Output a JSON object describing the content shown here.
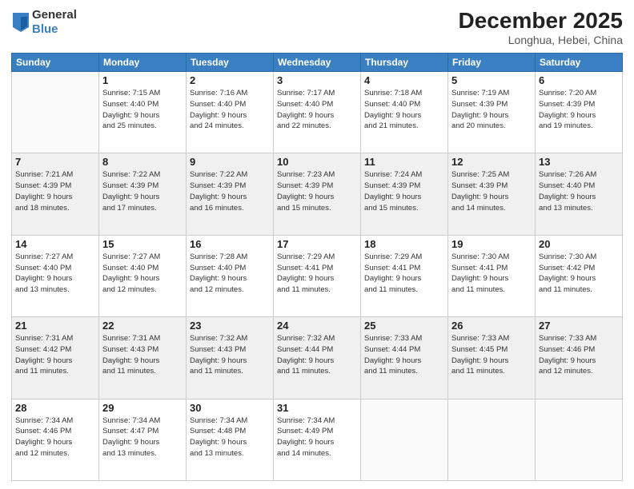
{
  "logo": {
    "general": "General",
    "blue": "Blue"
  },
  "title": {
    "month": "December 2025",
    "location": "Longhua, Hebei, China"
  },
  "weekdays": [
    "Sunday",
    "Monday",
    "Tuesday",
    "Wednesday",
    "Thursday",
    "Friday",
    "Saturday"
  ],
  "weeks": [
    [
      {
        "day": "",
        "detail": ""
      },
      {
        "day": "1",
        "detail": "Sunrise: 7:15 AM\nSunset: 4:40 PM\nDaylight: 9 hours\nand 25 minutes."
      },
      {
        "day": "2",
        "detail": "Sunrise: 7:16 AM\nSunset: 4:40 PM\nDaylight: 9 hours\nand 24 minutes."
      },
      {
        "day": "3",
        "detail": "Sunrise: 7:17 AM\nSunset: 4:40 PM\nDaylight: 9 hours\nand 22 minutes."
      },
      {
        "day": "4",
        "detail": "Sunrise: 7:18 AM\nSunset: 4:40 PM\nDaylight: 9 hours\nand 21 minutes."
      },
      {
        "day": "5",
        "detail": "Sunrise: 7:19 AM\nSunset: 4:39 PM\nDaylight: 9 hours\nand 20 minutes."
      },
      {
        "day": "6",
        "detail": "Sunrise: 7:20 AM\nSunset: 4:39 PM\nDaylight: 9 hours\nand 19 minutes."
      }
    ],
    [
      {
        "day": "7",
        "detail": "Sunrise: 7:21 AM\nSunset: 4:39 PM\nDaylight: 9 hours\nand 18 minutes."
      },
      {
        "day": "8",
        "detail": "Sunrise: 7:22 AM\nSunset: 4:39 PM\nDaylight: 9 hours\nand 17 minutes."
      },
      {
        "day": "9",
        "detail": "Sunrise: 7:22 AM\nSunset: 4:39 PM\nDaylight: 9 hours\nand 16 minutes."
      },
      {
        "day": "10",
        "detail": "Sunrise: 7:23 AM\nSunset: 4:39 PM\nDaylight: 9 hours\nand 15 minutes."
      },
      {
        "day": "11",
        "detail": "Sunrise: 7:24 AM\nSunset: 4:39 PM\nDaylight: 9 hours\nand 15 minutes."
      },
      {
        "day": "12",
        "detail": "Sunrise: 7:25 AM\nSunset: 4:39 PM\nDaylight: 9 hours\nand 14 minutes."
      },
      {
        "day": "13",
        "detail": "Sunrise: 7:26 AM\nSunset: 4:40 PM\nDaylight: 9 hours\nand 13 minutes."
      }
    ],
    [
      {
        "day": "14",
        "detail": "Sunrise: 7:27 AM\nSunset: 4:40 PM\nDaylight: 9 hours\nand 13 minutes."
      },
      {
        "day": "15",
        "detail": "Sunrise: 7:27 AM\nSunset: 4:40 PM\nDaylight: 9 hours\nand 12 minutes."
      },
      {
        "day": "16",
        "detail": "Sunrise: 7:28 AM\nSunset: 4:40 PM\nDaylight: 9 hours\nand 12 minutes."
      },
      {
        "day": "17",
        "detail": "Sunrise: 7:29 AM\nSunset: 4:41 PM\nDaylight: 9 hours\nand 11 minutes."
      },
      {
        "day": "18",
        "detail": "Sunrise: 7:29 AM\nSunset: 4:41 PM\nDaylight: 9 hours\nand 11 minutes."
      },
      {
        "day": "19",
        "detail": "Sunrise: 7:30 AM\nSunset: 4:41 PM\nDaylight: 9 hours\nand 11 minutes."
      },
      {
        "day": "20",
        "detail": "Sunrise: 7:30 AM\nSunset: 4:42 PM\nDaylight: 9 hours\nand 11 minutes."
      }
    ],
    [
      {
        "day": "21",
        "detail": "Sunrise: 7:31 AM\nSunset: 4:42 PM\nDaylight: 9 hours\nand 11 minutes."
      },
      {
        "day": "22",
        "detail": "Sunrise: 7:31 AM\nSunset: 4:43 PM\nDaylight: 9 hours\nand 11 minutes."
      },
      {
        "day": "23",
        "detail": "Sunrise: 7:32 AM\nSunset: 4:43 PM\nDaylight: 9 hours\nand 11 minutes."
      },
      {
        "day": "24",
        "detail": "Sunrise: 7:32 AM\nSunset: 4:44 PM\nDaylight: 9 hours\nand 11 minutes."
      },
      {
        "day": "25",
        "detail": "Sunrise: 7:33 AM\nSunset: 4:44 PM\nDaylight: 9 hours\nand 11 minutes."
      },
      {
        "day": "26",
        "detail": "Sunrise: 7:33 AM\nSunset: 4:45 PM\nDaylight: 9 hours\nand 11 minutes."
      },
      {
        "day": "27",
        "detail": "Sunrise: 7:33 AM\nSunset: 4:46 PM\nDaylight: 9 hours\nand 12 minutes."
      }
    ],
    [
      {
        "day": "28",
        "detail": "Sunrise: 7:34 AM\nSunset: 4:46 PM\nDaylight: 9 hours\nand 12 minutes."
      },
      {
        "day": "29",
        "detail": "Sunrise: 7:34 AM\nSunset: 4:47 PM\nDaylight: 9 hours\nand 13 minutes."
      },
      {
        "day": "30",
        "detail": "Sunrise: 7:34 AM\nSunset: 4:48 PM\nDaylight: 9 hours\nand 13 minutes."
      },
      {
        "day": "31",
        "detail": "Sunrise: 7:34 AM\nSunset: 4:49 PM\nDaylight: 9 hours\nand 14 minutes."
      },
      {
        "day": "",
        "detail": ""
      },
      {
        "day": "",
        "detail": ""
      },
      {
        "day": "",
        "detail": ""
      }
    ]
  ]
}
